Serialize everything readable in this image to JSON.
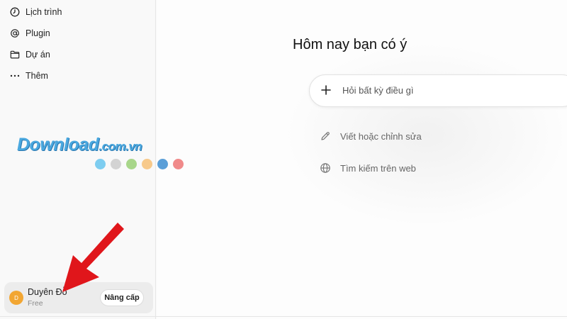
{
  "sidebar": {
    "items": [
      {
        "label": "Lịch trình",
        "icon": "clock-icon"
      },
      {
        "label": "Plugin",
        "icon": "at-sign-icon"
      },
      {
        "label": "Dự án",
        "icon": "folder-icon"
      },
      {
        "label": "Thêm",
        "icon": "more-dots-icon"
      }
    ],
    "user": {
      "initial": "D",
      "name": "Duyên Đỗ",
      "plan": "Free",
      "upgrade_label": "Nâng cấp"
    }
  },
  "main": {
    "headline": "Hôm nay bạn có ý",
    "prompt": {
      "placeholder": "Hỏi bất kỳ điều gì",
      "icon": "plus-icon"
    },
    "actions": [
      {
        "label": "Viết hoặc chỉnh sửa",
        "icon": "pencil-icon"
      },
      {
        "label": "Tìm kiếm trên web",
        "icon": "globe-icon"
      }
    ]
  },
  "watermark": {
    "text": "Download",
    "suffix": ".com.vn",
    "dot_colors": [
      "#7ecdf0",
      "#d3d3d3",
      "#a8d68a",
      "#f7c98a",
      "#5b9fd8",
      "#f08a8a"
    ]
  },
  "annotation": {
    "arrow_color": "#e0161b"
  }
}
